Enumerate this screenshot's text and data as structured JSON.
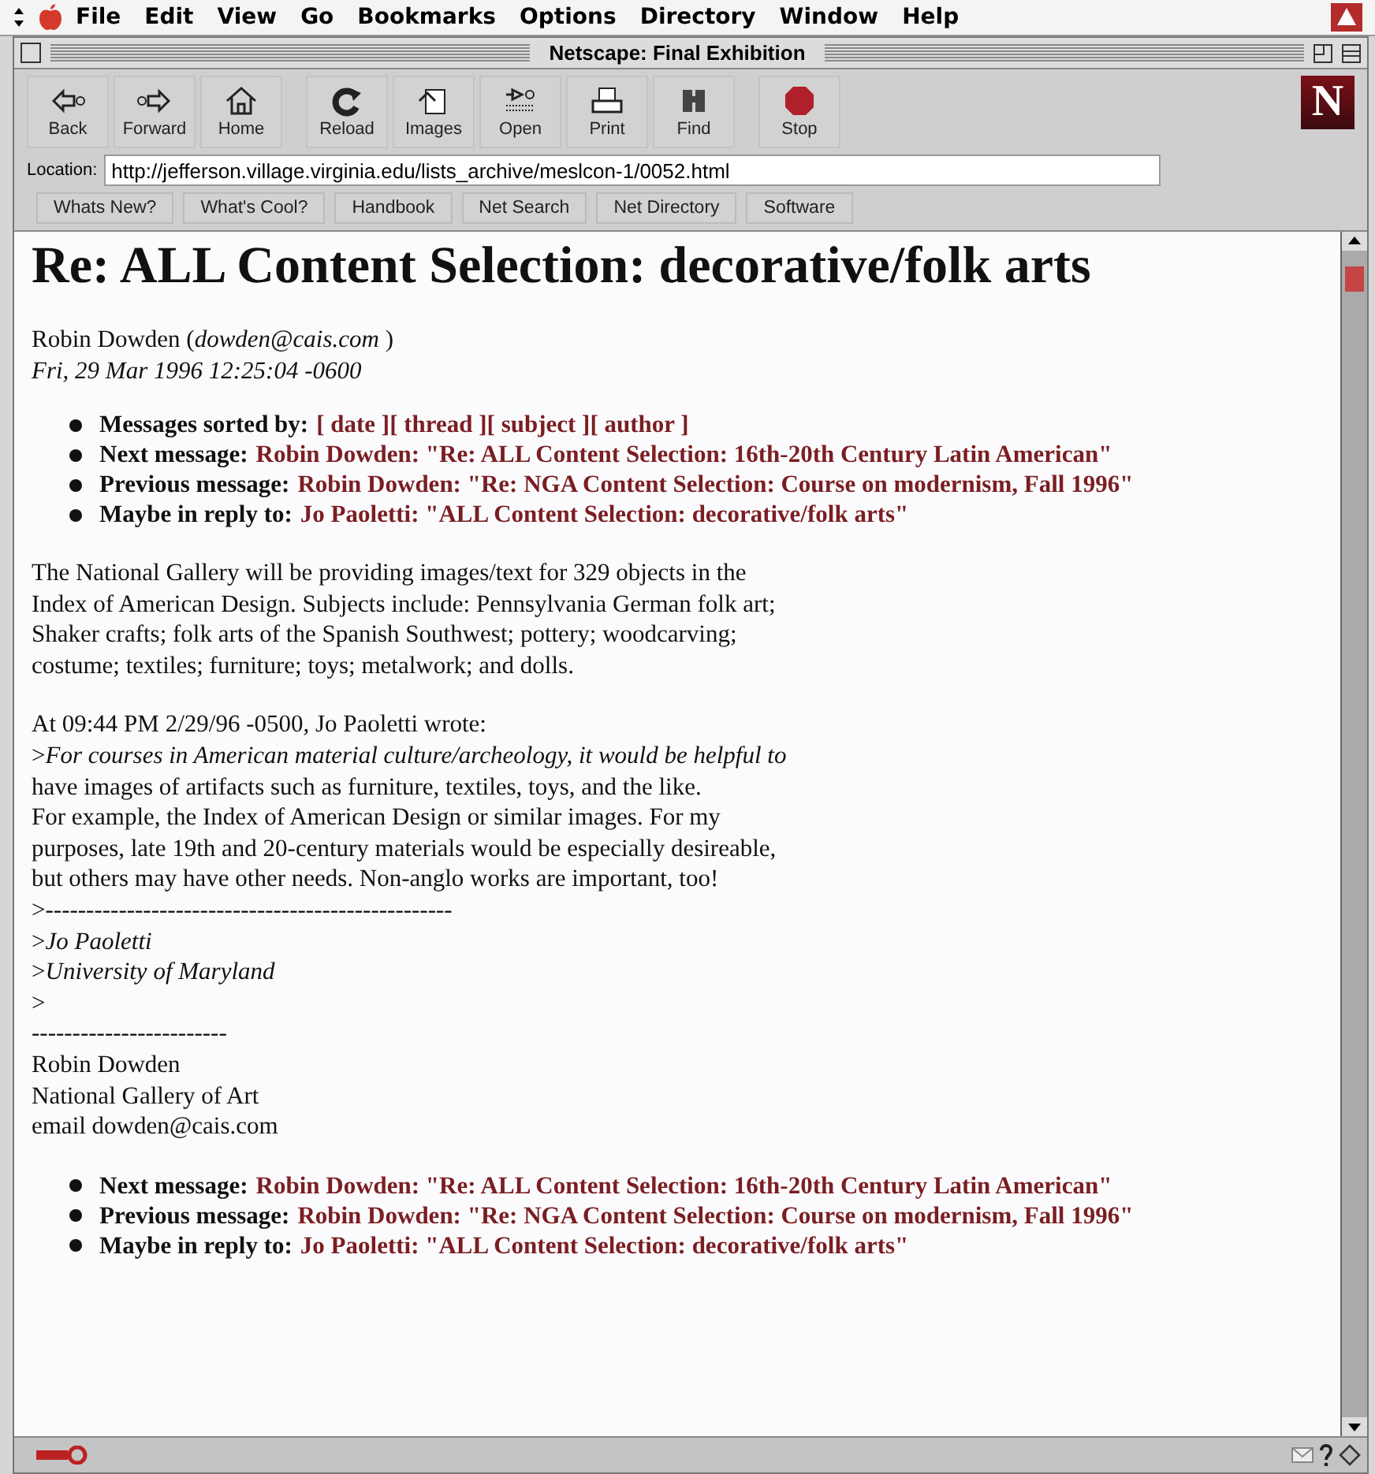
{
  "menu_bar": {
    "items": [
      "File",
      "Edit",
      "View",
      "Go",
      "Bookmarks",
      "Options",
      "Directory",
      "Window",
      "Help"
    ]
  },
  "window": {
    "title": "Netscape: Final Exhibition"
  },
  "toolbar": {
    "buttons": [
      {
        "label": "Back",
        "kind": "back"
      },
      {
        "label": "Forward",
        "kind": "forward"
      },
      {
        "label": "Home",
        "kind": "home"
      },
      {
        "label": "Reload",
        "kind": "reload"
      },
      {
        "label": "Images",
        "kind": "images"
      },
      {
        "label": "Open",
        "kind": "open"
      },
      {
        "label": "Print",
        "kind": "print"
      },
      {
        "label": "Find",
        "kind": "find"
      },
      {
        "label": "Stop",
        "kind": "stop"
      }
    ],
    "logo": "N"
  },
  "location": {
    "label": "Location:",
    "value": "http://jefferson.village.virginia.edu/lists_archive/meslcon-1/0052.html"
  },
  "directory_buttons": [
    "Whats New?",
    "What's Cool?",
    "Handbook",
    "Net Search",
    "Net Directory",
    "Software"
  ],
  "page": {
    "heading": "Re: ALL Content Selection: decorative/folk arts",
    "author": "Robin Dowden (*dowden@cais.com* )",
    "date": "Fri, 29 Mar 1996 12:25:04 -0600",
    "nav_top": [
      {
        "label": "Messages sorted by:",
        "link": "[ date ][ thread ][ subject ][ author ]"
      },
      {
        "label": "Next message:",
        "link": "Robin Dowden: \"Re: ALL Content Selection: 16th-20th Century Latin American\""
      },
      {
        "label": "Previous message:",
        "link": "Robin Dowden: \"Re: NGA Content Selection: Course on modernism, Fall 1996\""
      },
      {
        "label": "Maybe in reply to:",
        "link": "Jo Paoletti: \"ALL Content Selection: decorative/folk arts\""
      }
    ],
    "paragraphs": [
      [
        "The National Gallery will be providing images/text for 329 objects in the",
        "Index of American Design. Subjects include: Pennsylvania German folk art;",
        "Shaker crafts; folk arts of the Spanish Southwest; pottery; woodcarving;",
        "costume; textiles; furniture; toys; metalwork; and dolls."
      ],
      [
        "At 09:44 PM 2/29/96 -0500, Jo Paoletti wrote:",
        ">*For courses in American material culture/archeology, it would be helpful to*",
        "have images of artifacts such as furniture, textiles, toys, and the like.",
        "For example, the Index of American Design or similar images. For my",
        "purposes, late 19th and 20-century materials would be especially desireable,",
        "but others may have other needs. Non-anglo works are important, too!",
        ">--------------------------------------------------",
        ">*Jo Paoletti*",
        ">*University of Maryland*",
        ">",
        "------------------------",
        "Robin Dowden",
        "National Gallery of Art",
        "email dowden@cais.com"
      ]
    ],
    "nav_bottom": [
      {
        "label": "Next message:",
        "link": "Robin Dowden: \"Re: ALL Content Selection: 16th-20th Century Latin American\""
      },
      {
        "label": "Previous message:",
        "link": "Robin Dowden: \"Re: NGA Content Selection: Course on modernism, Fall 1996\""
      },
      {
        "label": "Maybe in reply to:",
        "link": "Jo Paoletti: \"ALL Content Selection: decorative/folk arts\""
      }
    ]
  }
}
